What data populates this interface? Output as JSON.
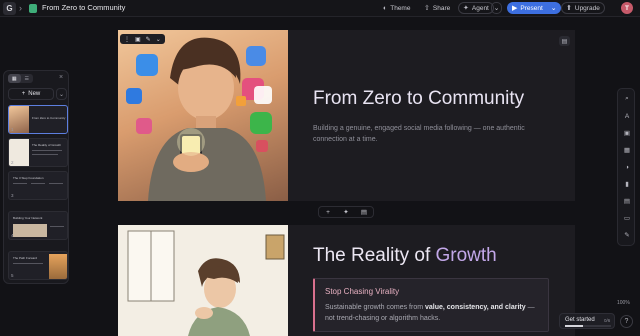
{
  "header": {
    "doc_title": "From Zero to Community",
    "theme_label": "Theme",
    "share_label": "Share",
    "agent_label": "Agent",
    "present_label": "Present",
    "upgrade_label": "Upgrade",
    "avatar_initial": "T"
  },
  "left_panel": {
    "new_label": "New",
    "thumbnails": [
      {
        "num": "1",
        "title": "From Zero to Community"
      },
      {
        "num": "2",
        "title": "The Reality of Growth"
      },
      {
        "num": "3",
        "title": "The 3 Step Foundation"
      },
      {
        "num": "4",
        "title": "Building Your Network"
      },
      {
        "num": "5",
        "title": "The Path Forward"
      }
    ]
  },
  "slide1": {
    "title": "From Zero to Community",
    "subtitle": "Building a genuine, engaged social media following — one authentic connection at a time."
  },
  "slide2": {
    "title_main": "The Reality of ",
    "title_accent": "Growth",
    "callout_heading": "Stop Chasing Virality",
    "callout_body_1": "Sustainable growth comes from ",
    "callout_body_bold": "value, consistency, and clarity",
    "callout_body_2": " — not trend-chasing or algorithm hacks."
  },
  "footer": {
    "zoom": "100%",
    "get_started_label": "Get started",
    "get_started_progress": "0/6",
    "get_started_fraction": 0.4
  },
  "colors": {
    "accent": "#3d6fe0",
    "callout_border": "#d9708e",
    "title_accent": "#c2a7e8"
  }
}
